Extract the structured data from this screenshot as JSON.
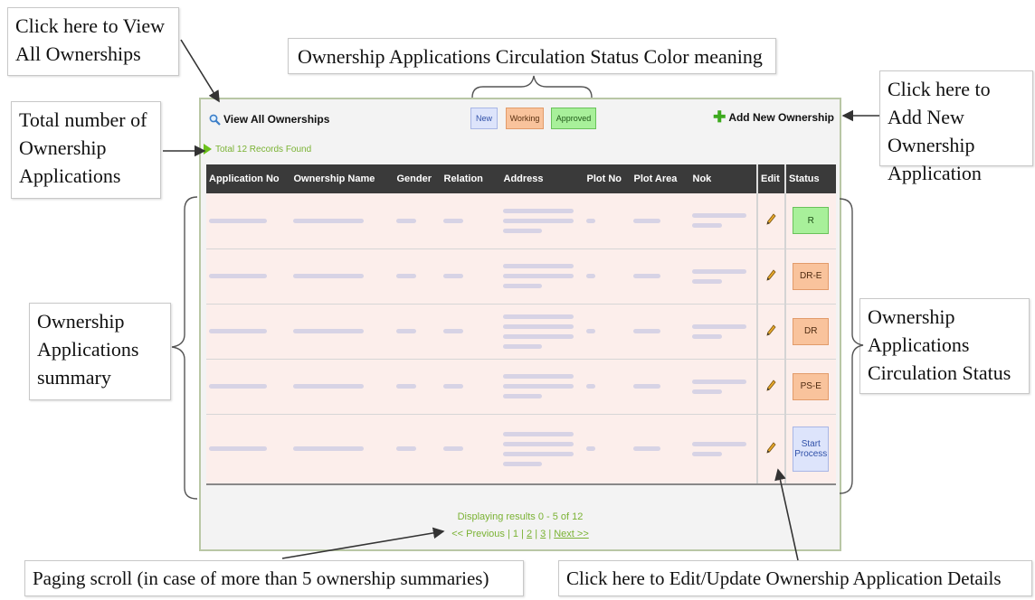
{
  "callouts": {
    "view_all": "Click here to View All Ownerships",
    "total": "Total number of Ownership Applications",
    "summary": "Ownership Applications summary",
    "legend": "Ownership Applications Circulation Status Color meaning",
    "add_new": "Click here to Add New Ownership Application",
    "status": "Ownership Applications Circulation Status",
    "paging": "Paging scroll (in case of more than 5 ownership summaries)",
    "edit": "Click here to Edit/Update Ownership Application Details"
  },
  "toolbar": {
    "view_all_label": "View All Ownerships",
    "add_new_label": "Add New Ownership"
  },
  "legend": {
    "new": "New",
    "working": "Working",
    "approved": "Approved"
  },
  "colors": {
    "new": "#dde4fb",
    "working": "#f9c39c",
    "approved": "#a8f09a",
    "header": "#3a3a3a",
    "row": "#fceeeb",
    "accent_green": "#7ab233"
  },
  "records_text": "Total 12 Records Found",
  "table": {
    "columns": [
      "Application No",
      "Ownership Name",
      "Gender",
      "Relation",
      "Address",
      "Plot No",
      "Plot Area",
      "Nok",
      "Edit",
      "Status"
    ],
    "rows": [
      {
        "status": "R",
        "status_color": "approved"
      },
      {
        "status": "DR-E",
        "status_color": "working"
      },
      {
        "status": "DR",
        "status_color": "working"
      },
      {
        "status": "PS-E",
        "status_color": "working"
      },
      {
        "status": "Start Process",
        "status_color": "new"
      }
    ]
  },
  "paging": {
    "info": "Displaying results 0 - 5 of 12",
    "prev": "<< Previous",
    "pages": [
      "1",
      "2",
      "3"
    ],
    "next": "Next >>"
  },
  "icons": {
    "view_all": "magnifier-icon",
    "add_new": "plus-icon",
    "records": "arrow-right-icon",
    "edit": "pencil-icon"
  }
}
